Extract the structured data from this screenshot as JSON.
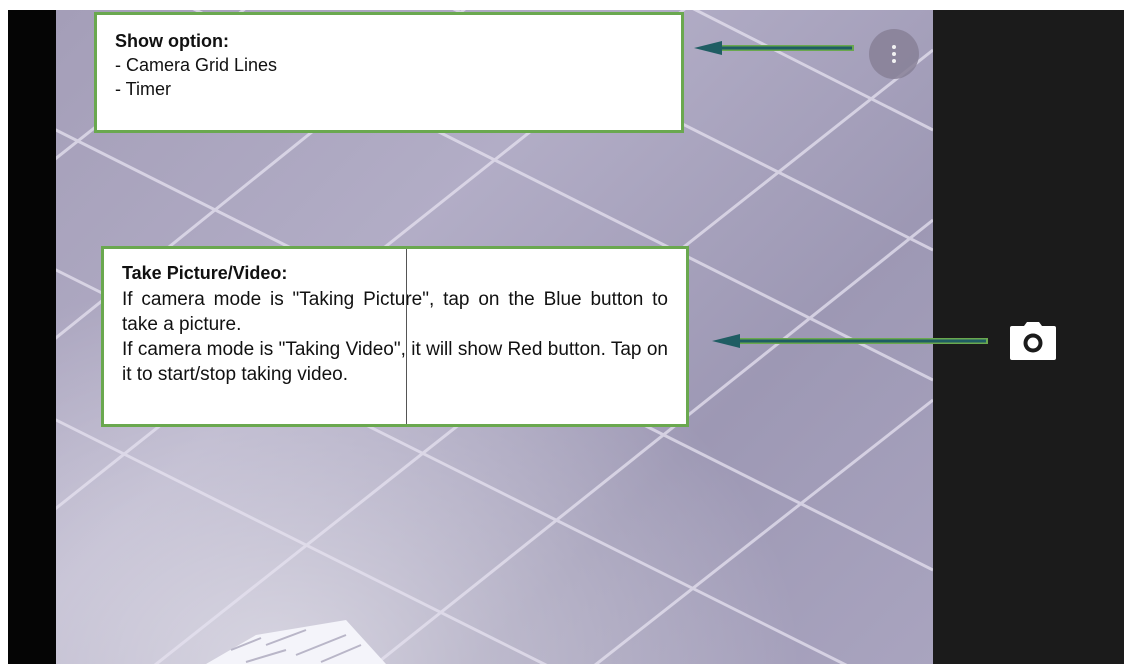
{
  "callouts": {
    "show_option": {
      "heading": "Show option:",
      "items": [
        "- Camera Grid Lines",
        "- Timer"
      ]
    },
    "take_picture": {
      "heading": "Take Picture/Video:",
      "paragraphs": [
        "If camera mode is \"Taking Picture\", tap on the Blue button to take a picture.",
        "If camera mode is \"Taking Video\", it will show Red button. Tap on it to start/stop taking video."
      ]
    }
  },
  "icons": {
    "more_options": "more-vert-icon",
    "shutter": "camera-icon"
  },
  "colors": {
    "callout_border": "#6aa84f",
    "arrow": "#1f5d63",
    "right_panel": "#1b1b1b"
  }
}
